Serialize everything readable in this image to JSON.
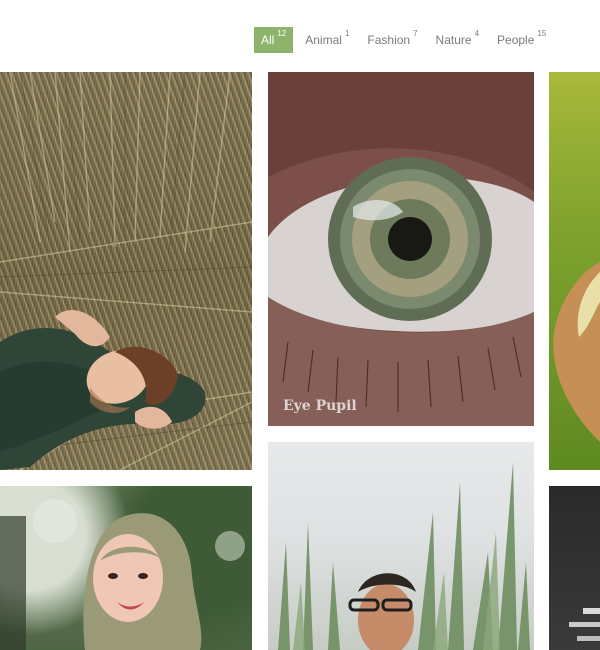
{
  "filters": [
    {
      "label": "All",
      "count": "12",
      "active": true
    },
    {
      "label": "Animal",
      "count": "1",
      "active": false
    },
    {
      "label": "Fashion",
      "count": "7",
      "active": false
    },
    {
      "label": "Nature",
      "count": "4",
      "active": false
    },
    {
      "label": "People",
      "count": "15",
      "active": false
    }
  ],
  "gallery": {
    "items": [
      {
        "subject": "man lying in dry grass",
        "caption": ""
      },
      {
        "subject": "eye close-up",
        "caption": "Eye Pupil"
      },
      {
        "subject": "person in green light",
        "caption": ""
      },
      {
        "subject": "woman wearing hijab",
        "caption": ""
      },
      {
        "subject": "man with glasses in tall grass",
        "caption": ""
      },
      {
        "subject": "dark interior with lights",
        "caption": ""
      }
    ]
  },
  "colors": {
    "accent": "#8db46a",
    "filter_text": "#7a7a7a",
    "background": "#ffffff"
  }
}
